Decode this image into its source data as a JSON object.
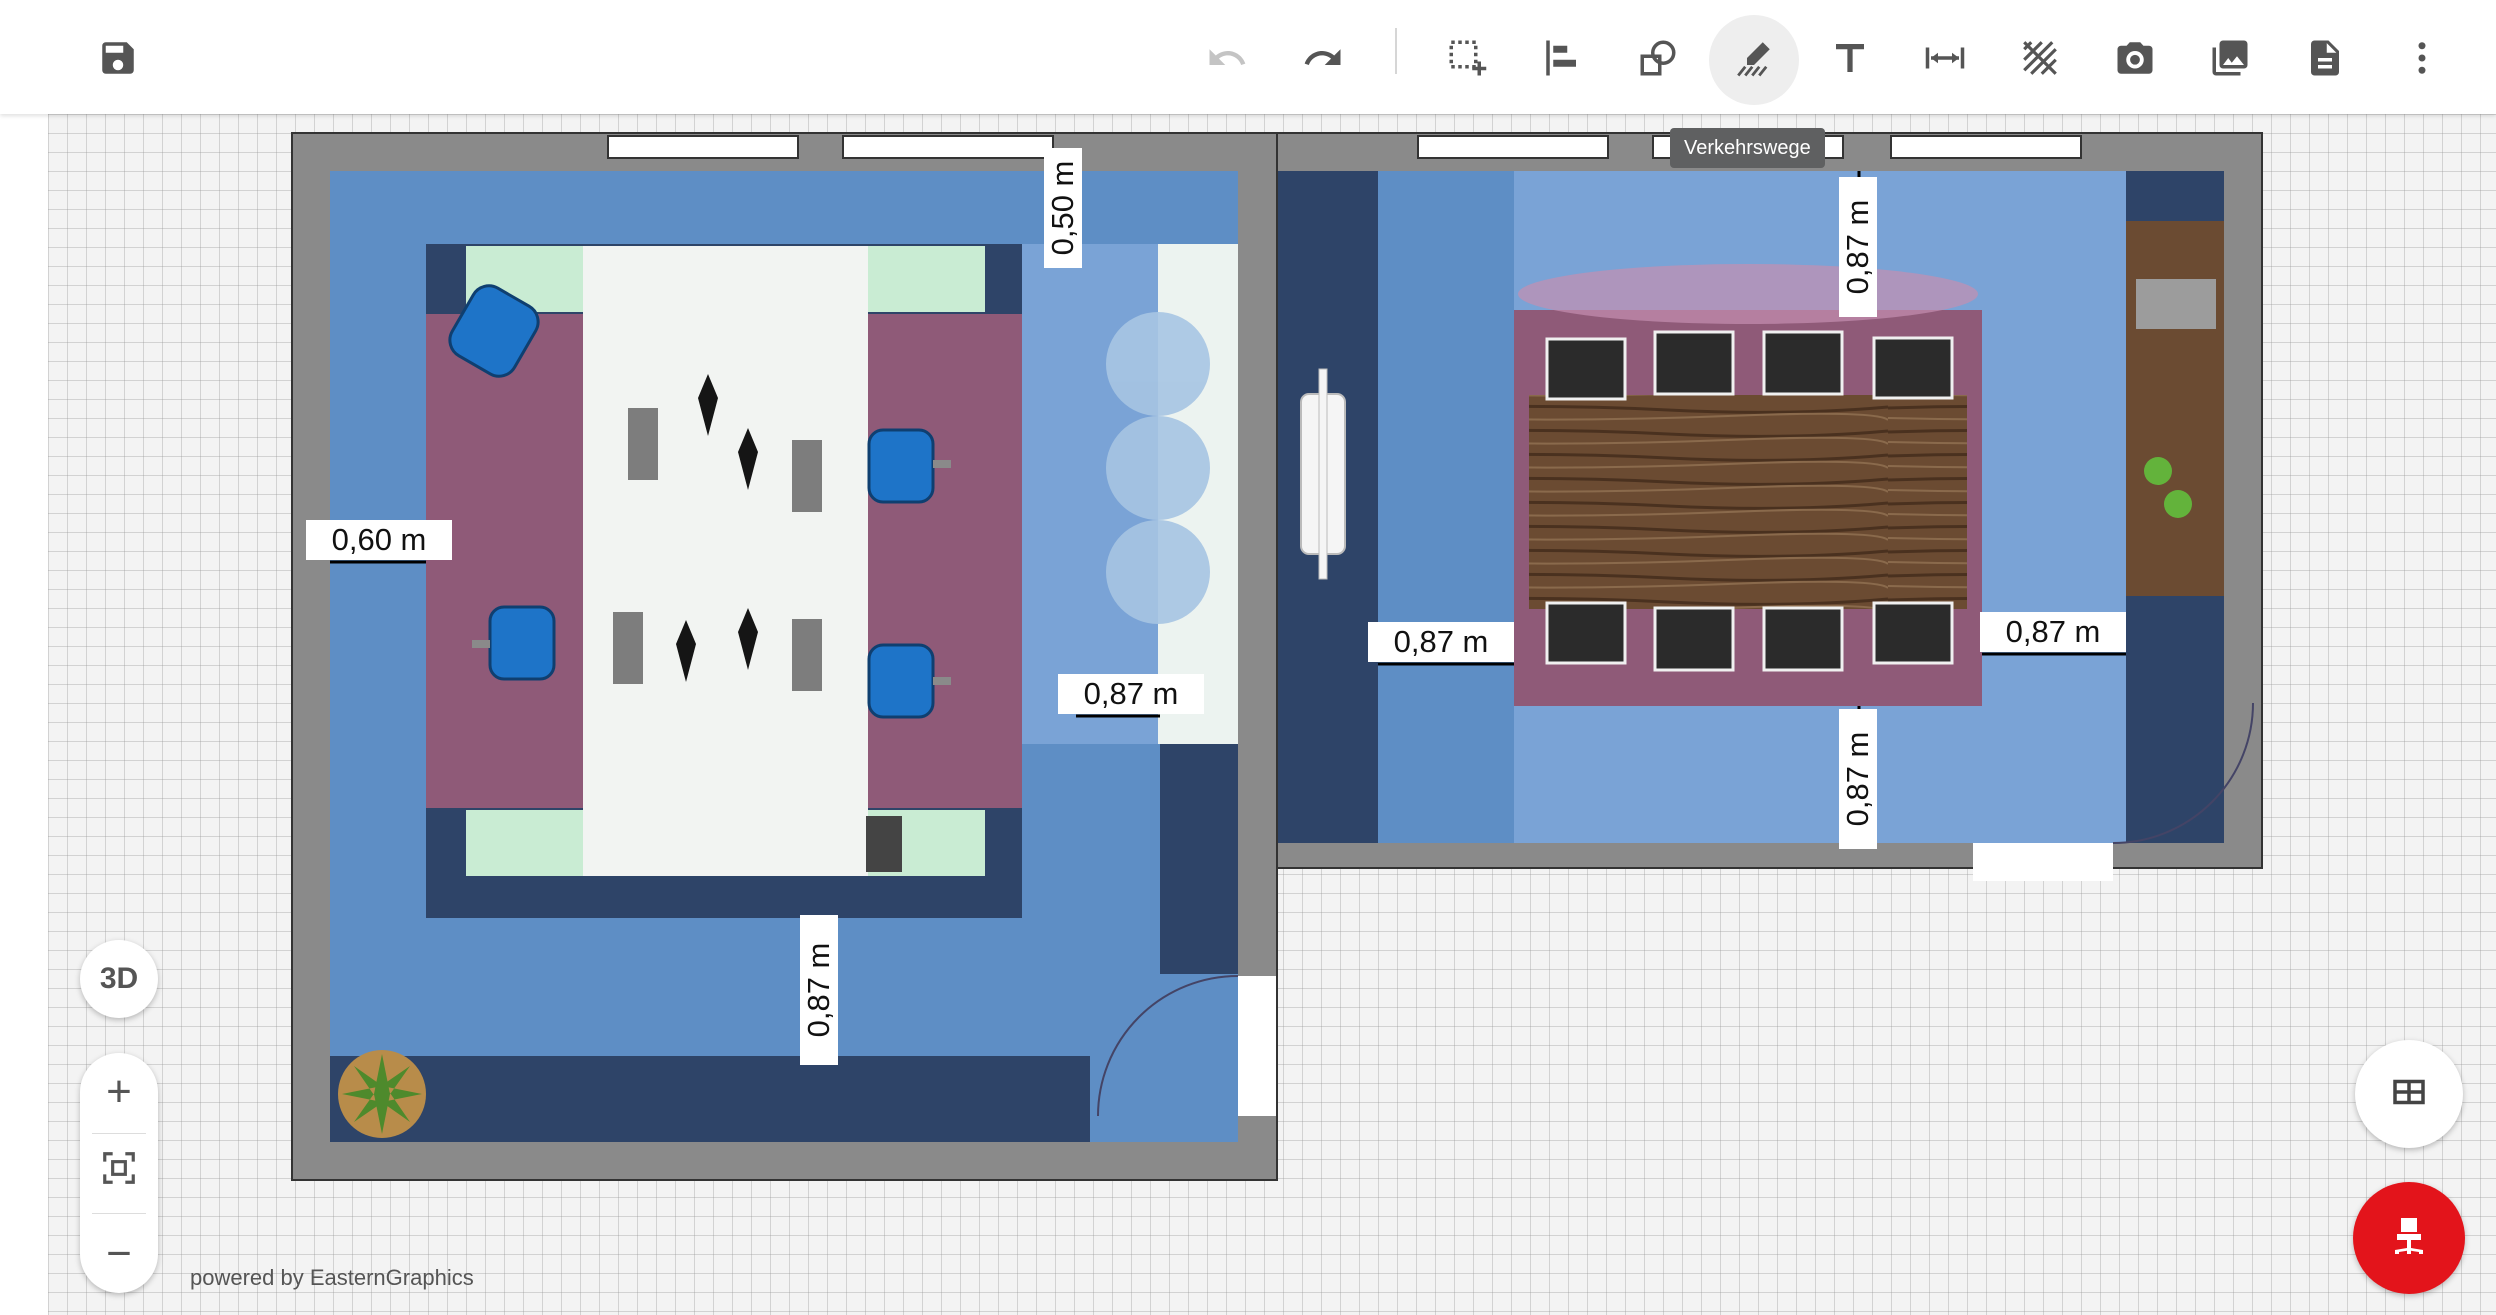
{
  "toolbar": {
    "left": [
      {
        "icon": "save-icon"
      }
    ],
    "right": [
      {
        "icon": "undo-icon",
        "enabled": false
      },
      {
        "icon": "redo-icon",
        "enabled": true
      },
      {
        "icon": "select-add-icon"
      },
      {
        "icon": "align-icon"
      },
      {
        "icon": "shapes-icon"
      },
      {
        "icon": "traffic-routes-icon",
        "active": true
      },
      {
        "icon": "text-icon"
      },
      {
        "icon": "dimension-icon"
      },
      {
        "icon": "hatch-area-icon"
      },
      {
        "icon": "camera-icon"
      },
      {
        "icon": "image-icon"
      },
      {
        "icon": "document-icon"
      },
      {
        "icon": "more-vert-icon"
      }
    ],
    "tooltip": "Verkehrswege"
  },
  "plan": {
    "dimensions": [
      "0,50  m",
      "0,60  m",
      "0,87  m",
      "0,87  m",
      "0,87  m",
      "0,87  m",
      "0,87  m",
      "0,87  m"
    ]
  },
  "controls": {
    "view_3d": "3D",
    "zoom_in": "+",
    "zoom_fit_icon": "fit-screen-icon",
    "zoom_out": "−",
    "layers_icon": "layers-grid-icon",
    "ofml_icon": "office-chair-icon"
  },
  "footer": {
    "powered_by": "powered by EasternGraphics"
  },
  "colors": {
    "wall": "#8a8a8a",
    "floor_blue": "#5e8ec5",
    "floor_light": "#7aa3d6",
    "floor_dark": "#2e4468",
    "desk_zone": "#8f5a78",
    "desk_top": "#f2f4f2",
    "accent_red": "#e3141b",
    "chair_blue": "#1e74c8",
    "table_wood": "#6b4b32"
  }
}
